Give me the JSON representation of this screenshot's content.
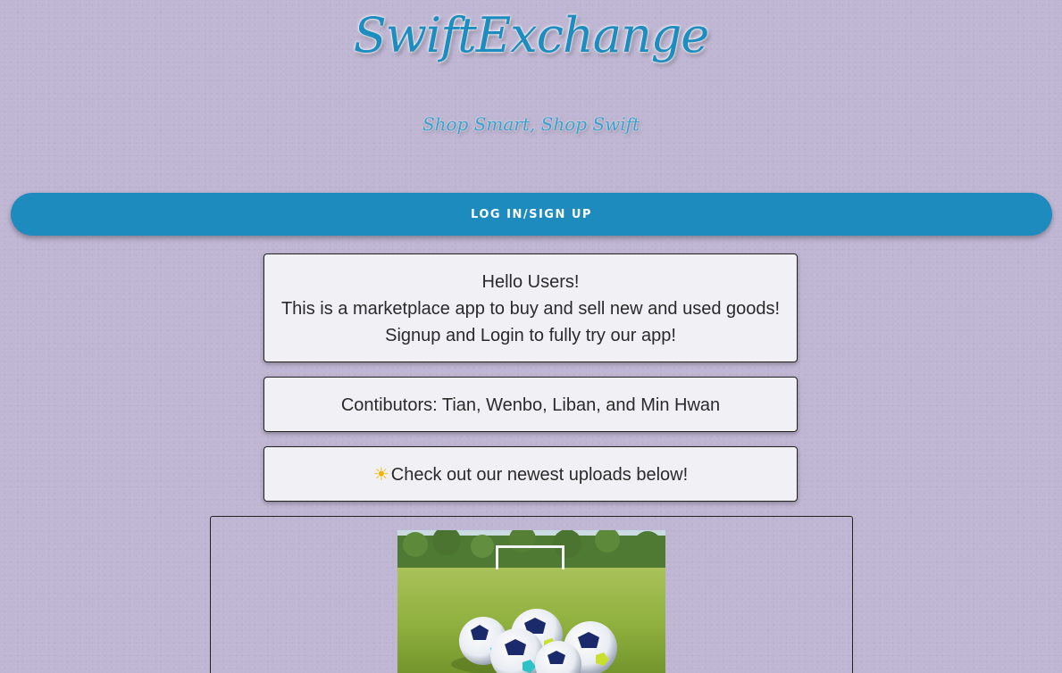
{
  "header": {
    "title": "SwiftExchange",
    "tagline": "Shop Smart, Shop Swift"
  },
  "auth": {
    "login_label": "LOG IN/SIGN UP"
  },
  "welcome": {
    "line1": "Hello Users!",
    "line2": "This is a marketplace app to buy and sell new and used goods!",
    "line3": "Signup and Login to fully try our app!"
  },
  "contributors": {
    "text": "Contibutors: Tian, Wenbo, Liban, and Min Hwan"
  },
  "newest": {
    "icon": "sun-icon",
    "text": "Check out our newest uploads below!"
  },
  "listing": {
    "image_alt": "soccer-balls-on-field"
  },
  "colors": {
    "background": "#bfb6d3",
    "accent": "#1e8bbe",
    "card_background": "#f1f0f5"
  }
}
